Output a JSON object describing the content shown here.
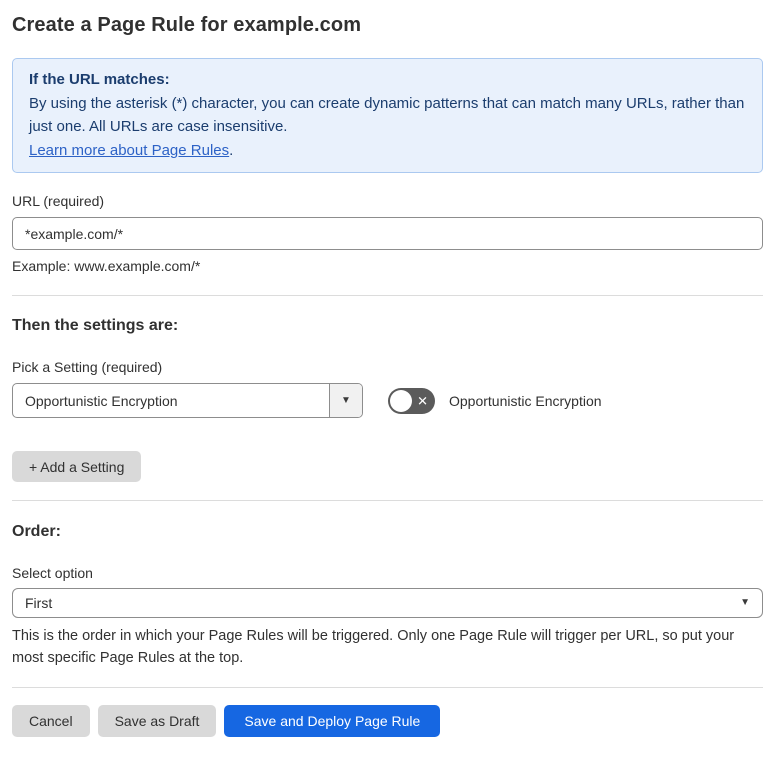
{
  "page": {
    "title": "Create a Page Rule for example.com"
  },
  "info_box": {
    "heading": "If the URL matches:",
    "body": "By using the asterisk (*) character, you can create dynamic patterns that can match many URLs, rather than just one. All URLs are case insensitive.",
    "link_label": "Learn more about Page Rules",
    "link_suffix": "."
  },
  "url_field": {
    "label": "URL (required)",
    "value": "*example.com/*",
    "helper": "Example: www.example.com/*"
  },
  "settings_section": {
    "heading": "Then the settings are:",
    "picker_label": "Pick a Setting (required)",
    "picker_value": "Opportunistic Encryption",
    "toggle_state": "off",
    "toggle_label": "Opportunistic Encryption",
    "add_setting_label": "+ Add a Setting"
  },
  "order_section": {
    "heading": "Order:",
    "select_label": "Select option",
    "select_value": "First",
    "helper": "This is the order in which your Page Rules will be triggered. Only one Page Rule will trigger per URL, so put your most specific Page Rules at the top."
  },
  "footer": {
    "cancel_label": "Cancel",
    "save_draft_label": "Save as Draft",
    "save_deploy_label": "Save and Deploy Page Rule"
  },
  "icons": {
    "caret_down": "▼",
    "toggle_off_x": "✕"
  },
  "colors": {
    "accent_blue": "#1667e2",
    "info_bg": "#e9f1fc",
    "info_border": "#abc9f0",
    "info_text": "#1b3d6e",
    "link_blue": "#2d62c6",
    "button_gray": "#d9d9d9",
    "toggle_off_bg": "#5b5b5b"
  }
}
